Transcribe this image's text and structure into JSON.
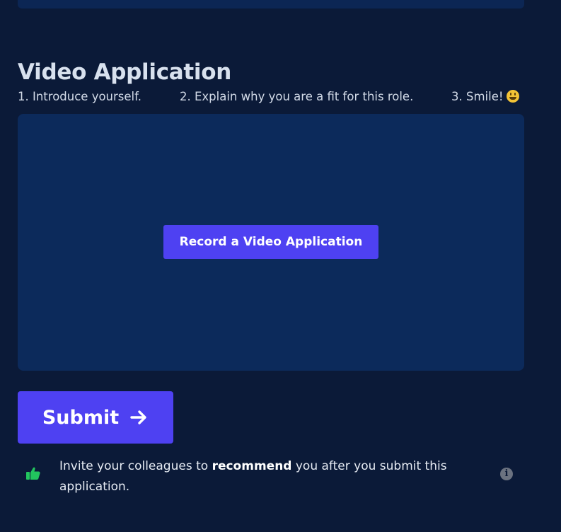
{
  "section": {
    "title": "Video Application",
    "steps": [
      "1. Introduce yourself.",
      "2. Explain why you are a fit for this role.",
      "3. Smile!"
    ]
  },
  "video_panel": {
    "record_label": "Record a Video Application"
  },
  "submit": {
    "label": "Submit",
    "icon": "arrow-right-icon"
  },
  "recommend": {
    "text_before": "Invite your colleagues to ",
    "text_bold": "recommend",
    "text_after": " you after you submit this application.",
    "icon": "thumbs-up-icon",
    "info_icon_glyph": "i"
  },
  "colors": {
    "background": "#0b1a38",
    "panel": "#0c2a5b",
    "accent": "#4e41f2",
    "thumb": "#22c55e",
    "smile": "#f3c336"
  }
}
